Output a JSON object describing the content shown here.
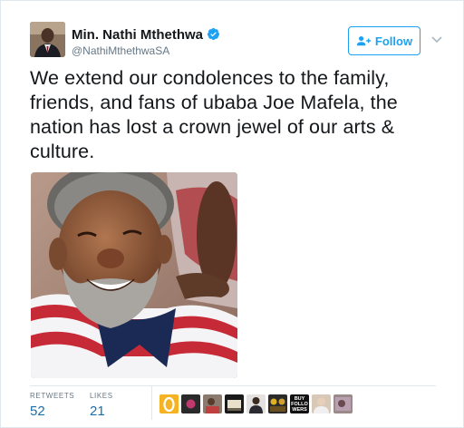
{
  "tweet": {
    "author_name": "Min. Nathi Mthethwa",
    "author_handle": "@NathiMthethwaSA",
    "follow_label": "Follow",
    "text": "We extend our condolences to the family, friends, and fans of ubaba Joe Mafela, the nation has lost a crown jewel of our arts & culture."
  },
  "stats": {
    "retweets_label": "RETWEETS",
    "retweets_value": "52",
    "likes_label": "LIKES",
    "likes_value": "21"
  },
  "likers": {
    "buy_followers_avatar_text": "BUY FOLLO WERS"
  },
  "colors": {
    "accent": "#1da1f2",
    "text": "#14171a",
    "muted": "#657786",
    "border": "#e1e8ed"
  }
}
